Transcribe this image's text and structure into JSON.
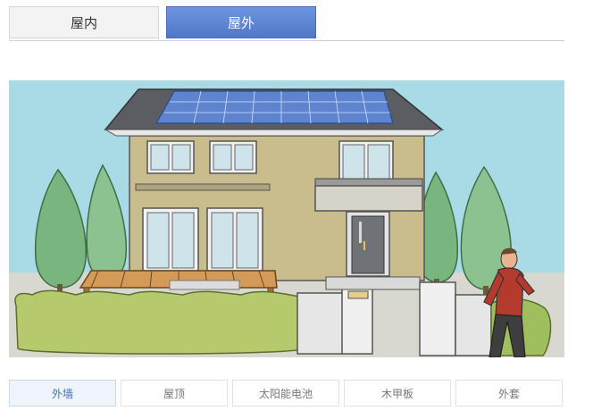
{
  "top_tabs": [
    {
      "label": "屋内",
      "active": false
    },
    {
      "label": "屋外",
      "active": true
    }
  ],
  "bottom_tabs": [
    {
      "label": "外墙",
      "active": true
    },
    {
      "label": "屋顶",
      "active": false
    },
    {
      "label": "太阳能电池",
      "active": false
    },
    {
      "label": "木甲板",
      "active": false
    },
    {
      "label": "外套",
      "active": false
    }
  ],
  "colors": {
    "accent": "#5a82d2",
    "sky": "#a9dbe6",
    "wall": "#c9bd8e",
    "roof": "#5b5d63",
    "solar_panel": "#5f84cf"
  }
}
